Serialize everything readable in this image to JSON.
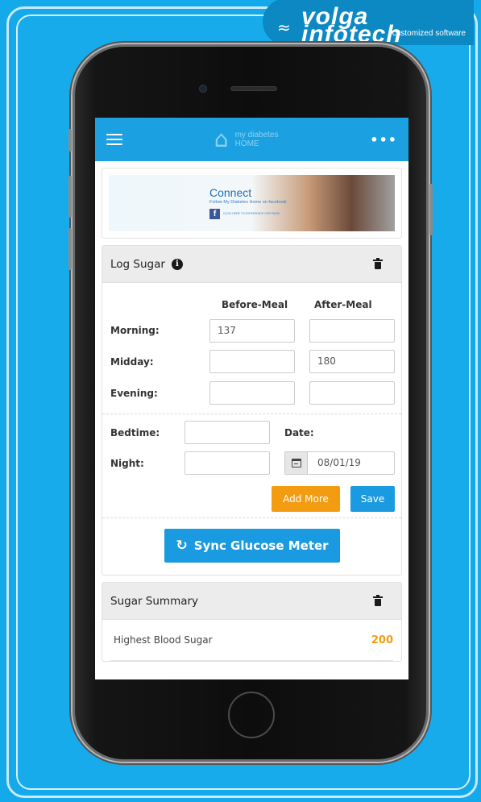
{
  "brand": {
    "name": "volga infotech",
    "tagline": "customized software"
  },
  "app": {
    "logo_text_line1": "my diabetes",
    "logo_text_line2": "HOME",
    "more_label": "•••"
  },
  "banner": {
    "heading": "Connect",
    "subtext": "Follow My Diabetes Home on facebook",
    "cta": "CLICK HERE TO EXPERIENCE OUR PAGE!",
    "fb_letter": "f"
  },
  "log_sugar": {
    "title": "Log Sugar",
    "col_before": "Before-Meal",
    "col_after": "After-Meal",
    "rows": [
      {
        "label": "Morning:",
        "before": "137",
        "after": ""
      },
      {
        "label": "Midday:",
        "before": "",
        "after": "180"
      },
      {
        "label": "Evening:",
        "before": "",
        "after": ""
      }
    ],
    "bedtime_label": "Bedtime:",
    "bedtime_value": "",
    "night_label": "Night:",
    "night_value": "",
    "date_label": "Date:",
    "date_value": "08/01/19",
    "add_more_label": "Add More",
    "save_label": "Save",
    "sync_label": "Sync Glucose Meter"
  },
  "summary": {
    "title": "Sugar Summary",
    "items": [
      {
        "label": "Highest Blood Sugar",
        "value": "200"
      }
    ]
  },
  "colors": {
    "accent_blue": "#1a9ae0",
    "accent_orange": "#f39c12",
    "background": "#14a9ea"
  }
}
